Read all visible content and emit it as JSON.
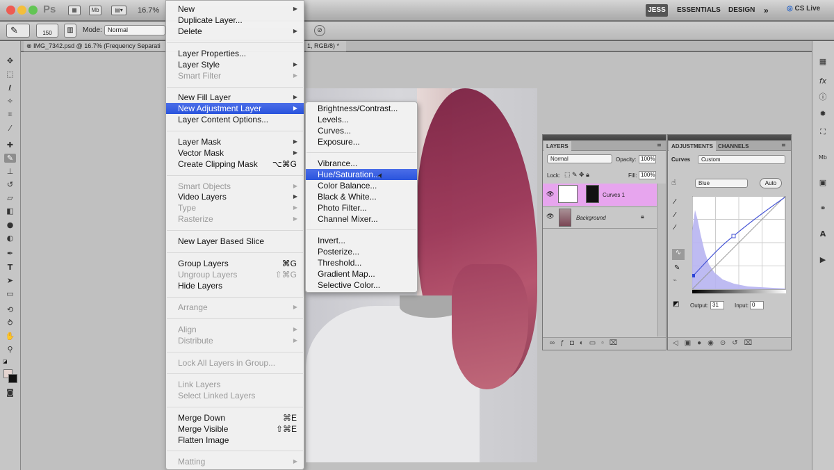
{
  "app": {
    "logo": "Ps",
    "zoom": "16.7%",
    "workspaces": [
      "JESS",
      "ESSENTIALS",
      "DESIGN",
      "»"
    ],
    "cs_live": "CS Live"
  },
  "options_bar": {
    "brush_size": "150",
    "mode_label": "Mode:",
    "mode_value": "Normal"
  },
  "document": {
    "tab_title": "IMG_7342.psd @ 16.7% (Frequency Separati",
    "tab_title_tail": "1, RGB/8) *"
  },
  "layer_menu": {
    "items": [
      {
        "label": "New",
        "arrow": "▶",
        "disabled": false
      },
      {
        "label": "Duplicate Layer...",
        "disabled": false
      },
      {
        "label": "Delete",
        "arrow": "▶",
        "disabled": false
      },
      {
        "label": "Layer Properties...",
        "disabled": false
      },
      {
        "label": "Layer Style",
        "arrow": "▶",
        "disabled": false
      },
      {
        "label": "Smart Filter",
        "arrow": "▶",
        "disabled": true
      },
      {
        "label": "New Fill Layer",
        "arrow": "▶",
        "disabled": false
      },
      {
        "label": "New Adjustment Layer",
        "arrow": "▶",
        "disabled": false,
        "highlighted": true
      },
      {
        "label": "Layer Content Options...",
        "disabled": false
      },
      {
        "label": "Layer Mask",
        "arrow": "▶",
        "disabled": false
      },
      {
        "label": "Vector Mask",
        "arrow": "▶",
        "disabled": false
      },
      {
        "label": "Create Clipping Mask",
        "shortcut": "⌥⌘G",
        "disabled": false
      },
      {
        "label": "Smart Objects",
        "arrow": "▶",
        "disabled": true
      },
      {
        "label": "Video Layers",
        "arrow": "▶",
        "disabled": false
      },
      {
        "label": "Type",
        "arrow": "▶",
        "disabled": true
      },
      {
        "label": "Rasterize",
        "arrow": "▶",
        "disabled": true
      },
      {
        "label": "New Layer Based Slice",
        "disabled": false
      },
      {
        "label": "Group Layers",
        "shortcut": "⌘G",
        "disabled": false
      },
      {
        "label": "Ungroup Layers",
        "shortcut": "⇧⌘G",
        "disabled": true
      },
      {
        "label": "Hide Layers",
        "disabled": false
      },
      {
        "label": "Arrange",
        "arrow": "▶",
        "disabled": true
      },
      {
        "label": "Align",
        "arrow": "▶",
        "disabled": true
      },
      {
        "label": "Distribute",
        "arrow": "▶",
        "disabled": true
      },
      {
        "label": "Lock All Layers in Group...",
        "disabled": true
      },
      {
        "label": "Link Layers",
        "disabled": true
      },
      {
        "label": "Select Linked Layers",
        "disabled": true
      },
      {
        "label": "Merge Down",
        "shortcut": "⌘E",
        "disabled": false
      },
      {
        "label": "Merge Visible",
        "shortcut": "⇧⌘E",
        "disabled": false
      },
      {
        "label": "Flatten Image",
        "disabled": false
      },
      {
        "label": "Matting",
        "arrow": "▶",
        "disabled": true
      }
    ]
  },
  "adjustment_submenu": {
    "items": [
      {
        "label": "Brightness/Contrast..."
      },
      {
        "label": "Levels..."
      },
      {
        "label": "Curves..."
      },
      {
        "label": "Exposure..."
      },
      {
        "label": "Vibrance..."
      },
      {
        "label": "Hue/Saturation...",
        "highlighted": true
      },
      {
        "label": "Color Balance..."
      },
      {
        "label": "Black & White..."
      },
      {
        "label": "Photo Filter..."
      },
      {
        "label": "Channel Mixer..."
      },
      {
        "label": "Invert..."
      },
      {
        "label": "Posterize..."
      },
      {
        "label": "Threshold..."
      },
      {
        "label": "Gradient Map..."
      },
      {
        "label": "Selective Color..."
      }
    ]
  },
  "layers_panel": {
    "tab": "LAYERS",
    "blend_mode": "Normal",
    "opacity_label": "Opacity:",
    "opacity_value": "100%",
    "lock_label": "Lock:",
    "fill_label": "Fill:",
    "fill_value": "100%",
    "layers": [
      {
        "name": "Curves 1",
        "selected": true
      },
      {
        "name": "Background",
        "selected": false
      }
    ]
  },
  "adjustments_panel": {
    "tabs": [
      "ADJUSTMENTS",
      "CHANNELS"
    ],
    "type_label": "Curves",
    "preset": "Custom",
    "channel": "Blue",
    "auto_label": "Auto",
    "output_label": "Output:",
    "output_value": "31",
    "input_label": "Input:",
    "input_value": "0"
  },
  "colors": {
    "highlight": "#2f58e0",
    "selected_layer": "#e8a6ee",
    "hair": "#8c2f4e"
  }
}
